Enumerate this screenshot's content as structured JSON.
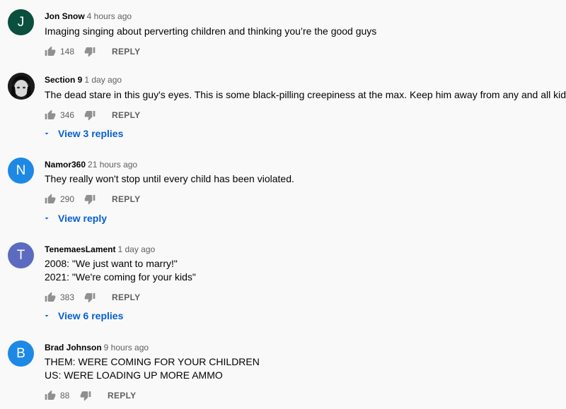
{
  "comments": [
    {
      "author": "Jon Snow",
      "time": "4 hours ago",
      "avatar_letter": "J",
      "avatar_color": "#0b4f3f",
      "lines": [
        "Imaging singing about perverting children and thinking you’re the good guys"
      ],
      "likes": "148",
      "reply_label": "REPLY"
    },
    {
      "author": "Section 9",
      "time": "1 day ago",
      "avatar_letter": "",
      "avatar_color": "#222222",
      "lines": [
        "The dead stare in this guy's eyes. This is some black-pilling creepiness at the max. Keep him away from any and all kids."
      ],
      "likes": "346",
      "reply_label": "REPLY",
      "view_replies": "View 3 replies"
    },
    {
      "author": "Namor360",
      "time": "21 hours ago",
      "avatar_letter": "N",
      "avatar_color": "#1e88e5",
      "lines": [
        "They really won't stop until every child has been violated."
      ],
      "likes": "290",
      "reply_label": "REPLY",
      "view_replies": "View reply"
    },
    {
      "author": "TenemaesLament",
      "time": "1 day ago",
      "avatar_letter": "T",
      "avatar_color": "#5c6bc0",
      "lines": [
        "2008: \"We just want to marry!\"",
        "2021: \"We're coming for your kids\""
      ],
      "likes": "383",
      "reply_label": "REPLY",
      "view_replies": "View 6 replies"
    },
    {
      "author": "Brad Johnson",
      "time": "9 hours ago",
      "avatar_letter": "B",
      "avatar_color": "#1e88e5",
      "lines": [
        "THEM: WERE COMING FOR YOUR CHILDREN",
        "US: WERE LOADING UP MORE AMMO"
      ],
      "likes": "88",
      "reply_label": "REPLY"
    }
  ]
}
